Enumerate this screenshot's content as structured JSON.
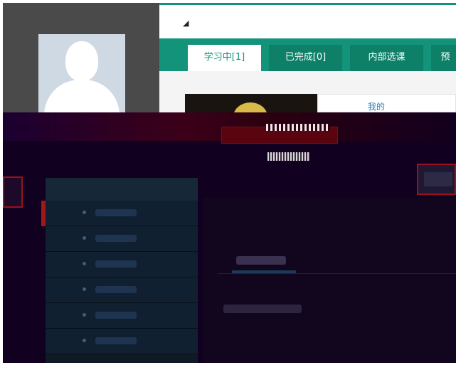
{
  "tabs": [
    {
      "label": "学习中[1]",
      "active": true
    },
    {
      "label": "已完成[0]",
      "active": false
    },
    {
      "label": "内部选课",
      "active": false
    },
    {
      "label": "预",
      "active": false
    }
  ],
  "content": {
    "course_title_fragment": "我的"
  },
  "icons": {
    "speaker": "speaker-icon",
    "avatar": "avatar-placeholder"
  },
  "colors": {
    "accent": "#13937a",
    "tab_bg": "#0e8068",
    "dark_bg": "#110020",
    "highlight_red": "#9a1020"
  }
}
